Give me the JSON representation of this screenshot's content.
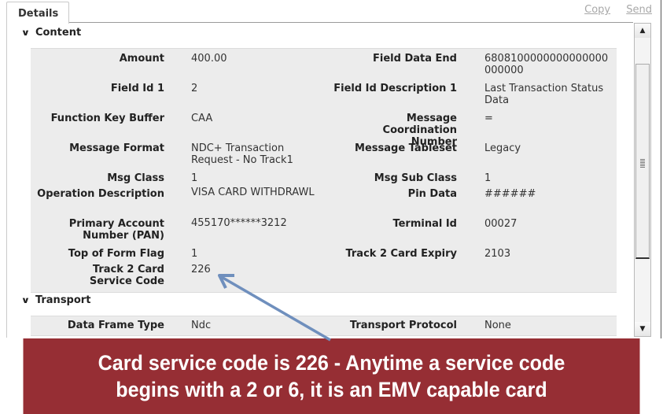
{
  "tab": {
    "label": "Details"
  },
  "actions": {
    "copy": "Copy",
    "send": "Send"
  },
  "content_section": {
    "title": "Content",
    "left_fields": [
      {
        "label": "Amount",
        "value": "400.00"
      },
      {
        "label": "Field Id 1",
        "value": "2"
      },
      {
        "label": "Function Key Buffer",
        "value": "CAA"
      },
      {
        "label": "Message Format",
        "value": "NDC+ Transaction Request - No Track1"
      },
      {
        "label": "Msg Class",
        "value": "1"
      },
      {
        "label": "Operation Description",
        "value": "VISA CARD WITHDRAWL"
      },
      {
        "label": "Primary Account Number (PAN)",
        "value": "455170******3212"
      },
      {
        "label": "Top of Form Flag",
        "value": "1"
      },
      {
        "label": "Track 2 Card Service Code",
        "value": "226"
      }
    ],
    "right_fields": [
      {
        "label": "Field Data End",
        "value": "6808100000000000000000000"
      },
      {
        "label": "Field Id Description 1",
        "value": "Last Transaction Status Data"
      },
      {
        "label": "Message Coordination Number",
        "value": "="
      },
      {
        "label": "Message Tableset",
        "value": "Legacy"
      },
      {
        "label": "Msg Sub Class",
        "value": "1"
      },
      {
        "label": "Pin Data",
        "value": "######"
      },
      {
        "label": "Terminal Id",
        "value": "00027"
      },
      {
        "label": "Track 2 Card Expiry",
        "value": "2103"
      }
    ]
  },
  "transport_section": {
    "title": "Transport",
    "fields": [
      {
        "label": "Data Frame Type",
        "value": "Ndc"
      },
      {
        "label": "Transport Protocol",
        "value": "None"
      }
    ]
  },
  "annotation": {
    "line1": "Card service code is 226 - Anytime a service code",
    "line2": "begins with a 2 or 6, it is an EMV capable card",
    "banner_color": "#962e34",
    "arrow_color": "#6f8fbd"
  }
}
